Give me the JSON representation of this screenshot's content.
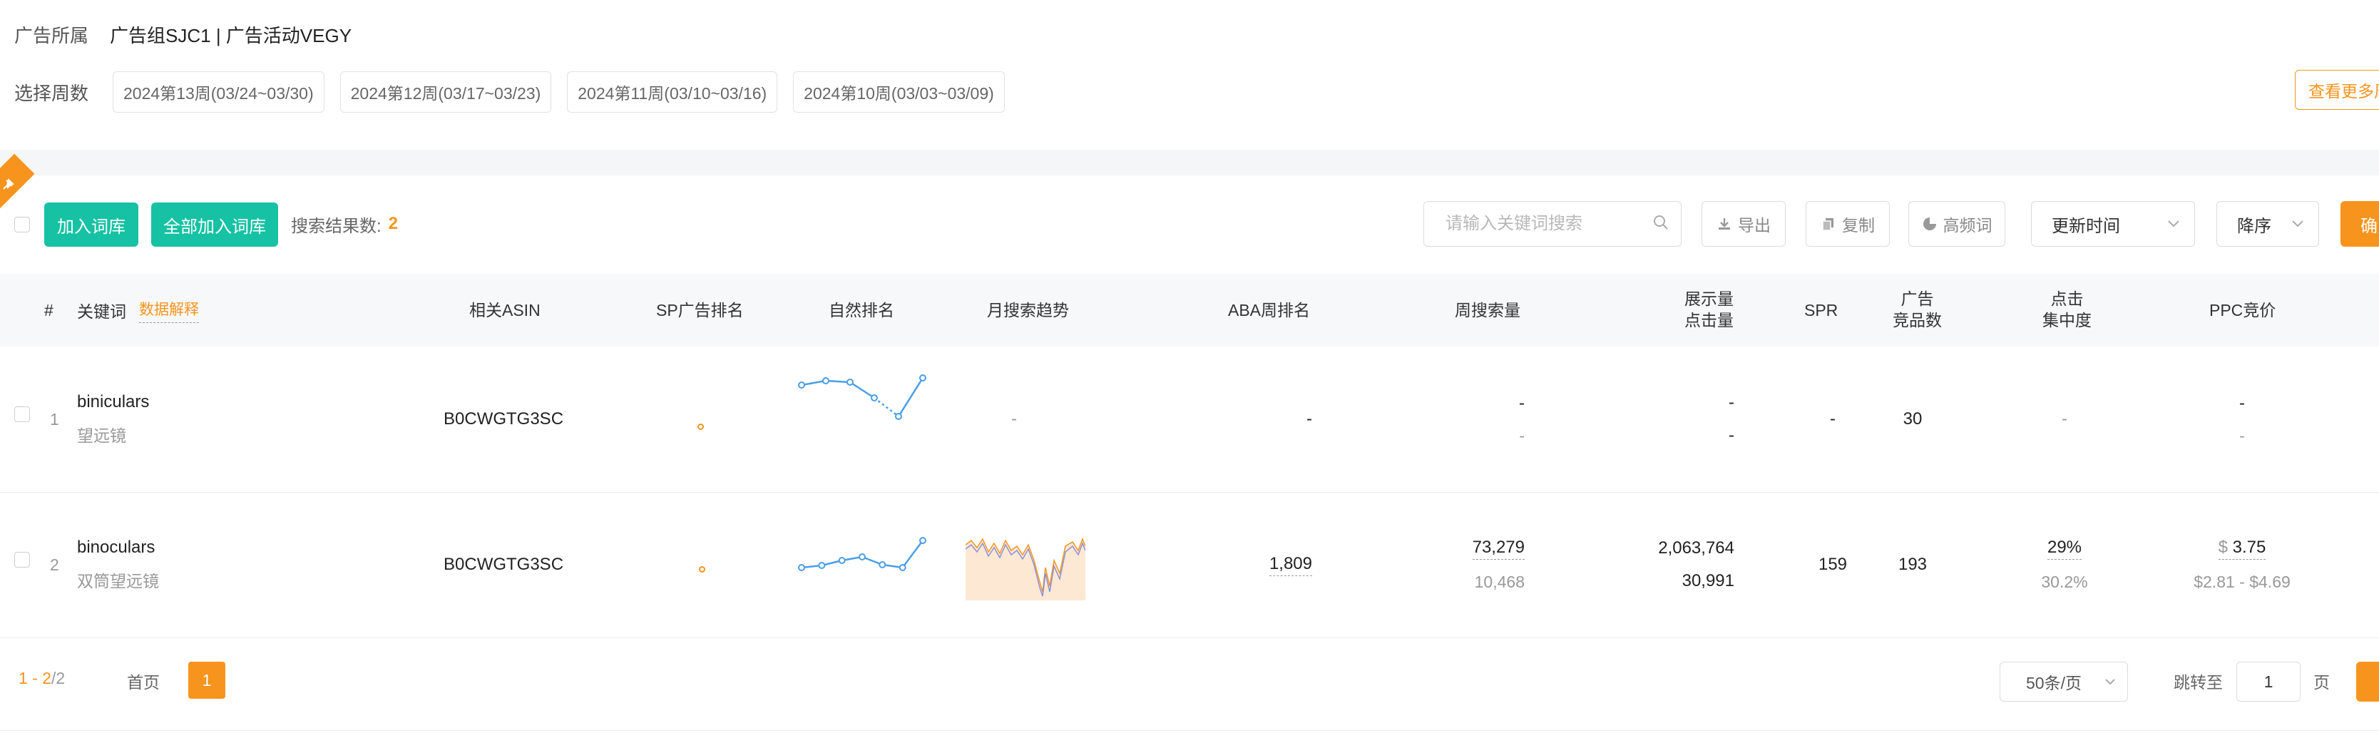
{
  "filter": {
    "owner_label": "广告所属",
    "owner_value": "广告组SJC1 | 广告活动VEGY",
    "weeks_label": "选择周数",
    "weeks": [
      "2024第13周(03/24~03/30)",
      "2024第12周(03/17~03/23)",
      "2024第11周(03/10~03/16)",
      "2024第10周(03/03~03/09)"
    ],
    "more_label": "查看更多周"
  },
  "toolbar": {
    "add_label": "加入词库",
    "add_all_label": "全部加入词库",
    "result_label": "搜索结果数:",
    "result_count": "2",
    "search_placeholder": "请输入关键词搜索",
    "export_label": "导出",
    "copy_label": "复制",
    "freq_label": "高频词",
    "sort_field": "更新时间",
    "sort_order": "降序",
    "confirm_label": "确"
  },
  "table": {
    "headers": {
      "index": "#",
      "keyword": "关键词",
      "data_explain": "数据解释",
      "asin": "相关ASIN",
      "sp_rank": "SP广告排名",
      "organic_rank": "自然排名",
      "monthly_trend": "月搜索趋势",
      "aba_rank": "ABA周排名",
      "weekly_search": "周搜索量",
      "impressions": "展示量",
      "clicks": "点击量",
      "spr": "SPR",
      "ad_comp_1": "广告",
      "ad_comp_2": "竞品数",
      "click_conc_1": "点击",
      "click_conc_2": "集中度",
      "ppc": "PPC竞价"
    },
    "rows": [
      {
        "index": "1",
        "keyword": "biniculars",
        "keyword_zh": "望远镜",
        "asin": "B0CWGTG3SC",
        "organic_trend": [
          14,
          8,
          10,
          32,
          58,
          4
        ],
        "monthly_trend": "-",
        "aba_rank": "-",
        "weekly_search": "-",
        "weekly_search_sub": "-",
        "impressions": "-",
        "clicks": "-",
        "spr": "-",
        "ad_competitors": "30",
        "click_concentration": "-",
        "ppc": "-",
        "ppc_range": "-"
      },
      {
        "index": "2",
        "keyword": "binoculars",
        "keyword_zh": "双筒望远镜",
        "asin": "B0CWGTG3SC",
        "organic_trend": [
          42,
          39,
          32,
          27,
          38,
          42,
          4
        ],
        "aba_rank": "1,809",
        "weekly_search": "73,279",
        "weekly_search_sub": "10,468",
        "impressions": "2,063,764",
        "clicks": "30,991",
        "spr": "159",
        "ad_competitors": "193",
        "click_concentration": "29%",
        "click_concentration_sub": "30.2%",
        "ppc_currency": "$",
        "ppc": "3.75",
        "ppc_range": "$2.81 - $4.69"
      }
    ]
  },
  "pagination": {
    "range_start": "1",
    "range_sep": " - ",
    "range_end": "2",
    "total": "/2",
    "first_label": "首页",
    "current_page": "1",
    "page_size": "50条/页",
    "jump_label": "跳转至",
    "jump_value": "1",
    "page_unit": "页"
  },
  "colors": {
    "accent": "#f7941d",
    "green": "#16c2a3",
    "line": "#4a9eea"
  }
}
